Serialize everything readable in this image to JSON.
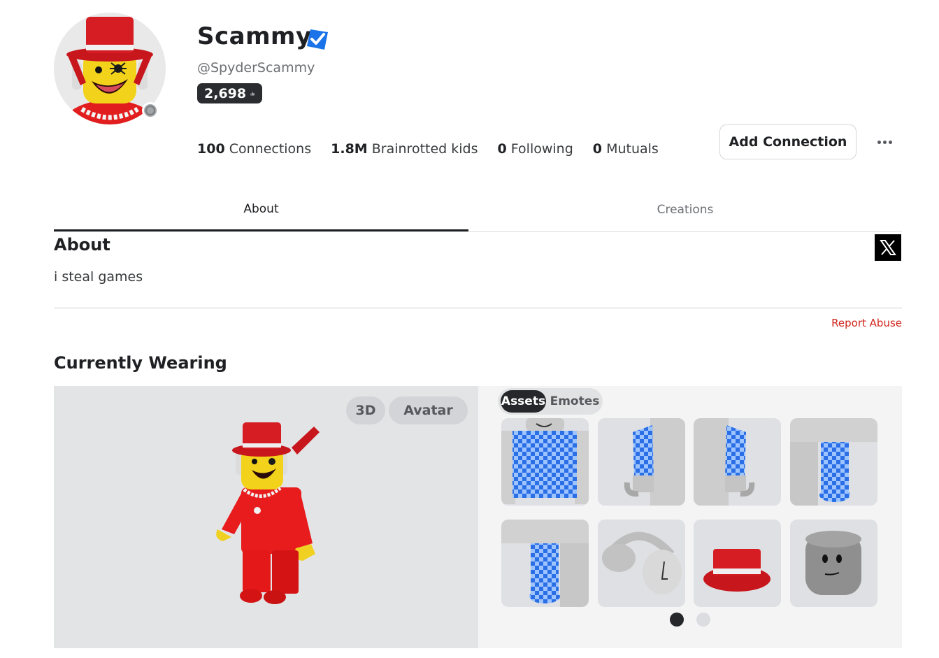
{
  "profile": {
    "display_name": "Scammy",
    "username": "@SpyderScammy",
    "likes": "2,698",
    "presence": "offline",
    "verified": true
  },
  "stats": [
    {
      "value": "100",
      "label": "Connections"
    },
    {
      "value": "1.8M",
      "label": "Brainrotted kids"
    },
    {
      "value": "0",
      "label": "Following"
    },
    {
      "value": "0",
      "label": "Mutuals"
    }
  ],
  "actions": {
    "add_connection": "Add Connection",
    "more_icon": "ellipsis-icon"
  },
  "tabs": [
    {
      "label": "About",
      "active": true
    },
    {
      "label": "Creations",
      "active": false
    }
  ],
  "about": {
    "title": "About",
    "text": "i steal games",
    "social_icon": "x-logo-icon",
    "report": "Report Abuse"
  },
  "wearing": {
    "title": "Currently Wearing",
    "view_buttons": [
      "3D",
      "Avatar"
    ],
    "segments": [
      {
        "label": "Assets",
        "active": true
      },
      {
        "label": "Emotes",
        "active": false
      }
    ],
    "assets": [
      {
        "name": "checkered-shirt-torso"
      },
      {
        "name": "checkered-right-arm"
      },
      {
        "name": "checkered-left-arm"
      },
      {
        "name": "checkered-right-leg"
      },
      {
        "name": "checkered-left-leg"
      },
      {
        "name": "headphones-accessory"
      },
      {
        "name": "red-top-hat"
      },
      {
        "name": "default-head"
      }
    ],
    "pages": 2,
    "current_page": 1
  },
  "colors": {
    "accent_red": "#d0251c",
    "verified_blue": "#1a73e8",
    "avatar_red": "#e31b1b",
    "check_blue": "#2b6fe6"
  }
}
